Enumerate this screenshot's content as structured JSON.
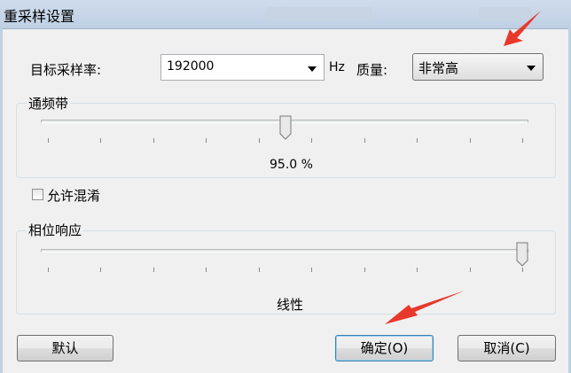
{
  "window": {
    "title": "重采样设置"
  },
  "target_rate": {
    "label": "目标采样率:",
    "value": "192000",
    "unit": "Hz"
  },
  "quality": {
    "label": "质量:",
    "value": "非常高"
  },
  "passband": {
    "title": "通频带",
    "value_text": "95.0 %",
    "level": 0.5
  },
  "allow_aliasing": {
    "label": "允许混淆",
    "checked": false
  },
  "phase_response": {
    "title": "相位响应",
    "value_text": "线性",
    "level": 1.0
  },
  "buttons": {
    "default": "默认",
    "ok": "确定(O)",
    "cancel": "取消(C)"
  },
  "annotation_color": "#e8382c"
}
